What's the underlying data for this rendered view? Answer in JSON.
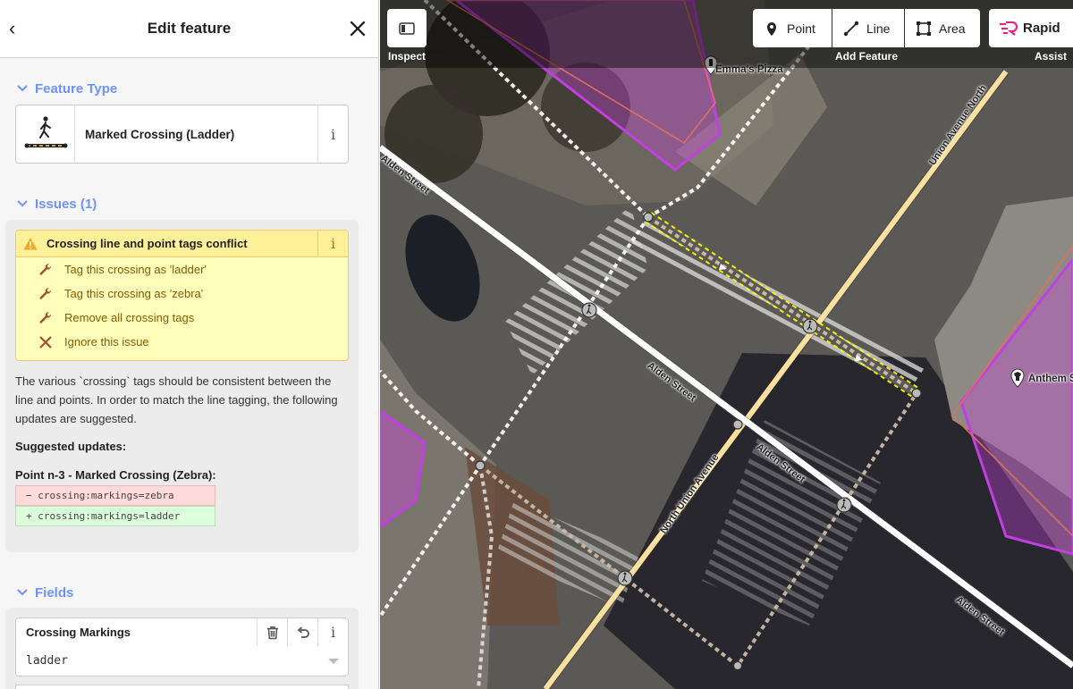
{
  "sidebar": {
    "title": "Edit feature",
    "feature_type": {
      "section_label": "Feature Type",
      "preset_name": "Marked Crossing (Ladder)",
      "info": "i"
    },
    "issues": {
      "section_label": "Issues (1)",
      "issue_message": "Crossing line and point tags conflict",
      "info": "i",
      "fixes": [
        {
          "label": "Tag this crossing as 'ladder'",
          "icon": "wrench-icon"
        },
        {
          "label": "Tag this crossing as 'zebra'",
          "icon": "wrench-icon"
        },
        {
          "label": "Remove all crossing tags",
          "icon": "wrench-icon"
        },
        {
          "label": "Ignore this issue",
          "icon": "x-icon"
        }
      ],
      "description": "The various `crossing` tags should be consistent between the line and points. In order to match the line tagging, the following updates are suggested.",
      "suggested_title": "Suggested updates:",
      "point_title": "Point n-3 - Marked Crossing (Zebra):",
      "diff_removed": "− crossing:markings=zebra",
      "diff_added": "+ crossing:markings=ladder"
    },
    "fields": {
      "section_label": "Fields",
      "field_label": "Crossing Markings",
      "field_value": "ladder",
      "info": "i"
    }
  },
  "toolbar": {
    "inspect_caption": "Inspect",
    "point_label": "Point",
    "line_label": "Line",
    "area_label": "Area",
    "add_feature_caption": "Add Feature",
    "rapid_label": "Rapid",
    "assist_caption": "Assist"
  },
  "map": {
    "poi_emmas": "Emma's Pizza",
    "poi_anthem": "Anthem S",
    "streets": [
      "Alden Street",
      "Alden Street",
      "Alden Street",
      "Alden Street",
      "North Union Avenue",
      "Union Avenue North"
    ]
  },
  "colors": {
    "accent": "#7092ff",
    "issue_bg": "#ffffbb",
    "issue_head": "#fff19a",
    "primary_road": "#f9d371",
    "building": "#d041e4"
  }
}
